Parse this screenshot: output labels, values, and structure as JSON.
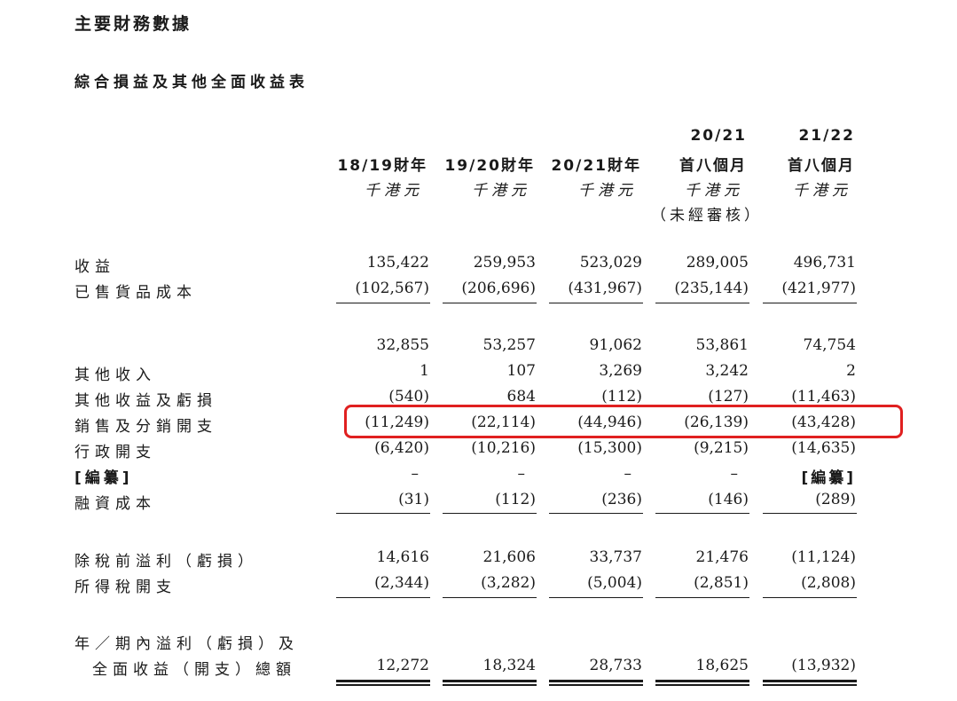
{
  "title": "主要財務數據",
  "subtitle": "綜合損益及其他全面收益表",
  "columns": [
    {
      "line1": "",
      "line2": "18/19財年",
      "unit": "千港元",
      "note": ""
    },
    {
      "line1": "",
      "line2": "19/20財年",
      "unit": "千港元",
      "note": ""
    },
    {
      "line1": "",
      "line2": "20/21財年",
      "unit": "千港元",
      "note": ""
    },
    {
      "line1": "20/21",
      "line2": "首八個月",
      "unit": "千港元",
      "note": "（未經審核）"
    },
    {
      "line1": "21/22",
      "line2": "首八個月",
      "unit": "千港元",
      "note": ""
    }
  ],
  "rows": [
    {
      "label": "收益",
      "values": [
        "135,422",
        "259,953",
        "523,029",
        "289,005",
        "496,731"
      ]
    },
    {
      "label": "已售貨品成本",
      "values": [
        "(102,567)",
        "(206,696)",
        "(431,967)",
        "(235,144)",
        "(421,977)"
      ]
    },
    {
      "label": "",
      "values": [
        "32,855",
        "53,257",
        "91,062",
        "53,861",
        "74,754"
      ]
    },
    {
      "label": "其他收入",
      "values": [
        "1",
        "107",
        "3,269",
        "3,242",
        "2"
      ]
    },
    {
      "label": "其他收益及虧損",
      "values": [
        "(540)",
        "684",
        "(112)",
        "(127)",
        "(11,463)"
      ]
    },
    {
      "label": "銷售及分銷開支",
      "values": [
        "(11,249)",
        "(22,114)",
        "(44,946)",
        "(26,139)",
        "(43,428)"
      ]
    },
    {
      "label": "行政開支",
      "values": [
        "(6,420)",
        "(10,216)",
        "(15,300)",
        "(9,215)",
        "(14,635)"
      ]
    },
    {
      "label": "[編纂]",
      "values": [
        "–",
        "–",
        "–",
        "–",
        "[編纂]"
      ]
    },
    {
      "label": "融資成本",
      "values": [
        "(31)",
        "(112)",
        "(236)",
        "(146)",
        "(289)"
      ]
    },
    {
      "label": "除稅前溢利（虧損）",
      "values": [
        "14,616",
        "21,606",
        "33,737",
        "21,476",
        "(11,124)"
      ]
    },
    {
      "label": "所得稅開支",
      "values": [
        "(2,344)",
        "(3,282)",
        "(5,004)",
        "(2,851)",
        "(2,808)"
      ]
    },
    {
      "label": "年／期內溢利（虧損）及",
      "values": [
        "",
        "",
        "",
        "",
        ""
      ]
    },
    {
      "label": "全面收益（開支）總額",
      "values": [
        "12,272",
        "18,324",
        "28,733",
        "18,625",
        "(13,932)"
      ]
    }
  ],
  "highlight_color": "#e02020"
}
